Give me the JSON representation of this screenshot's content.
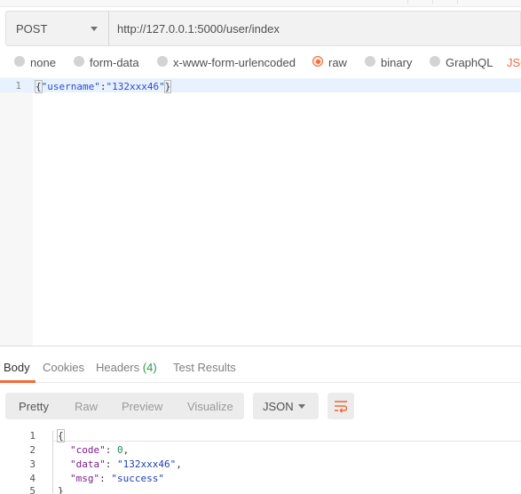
{
  "request": {
    "method": "POST",
    "url": "http://127.0.0.1:5000/user/index"
  },
  "body_types": {
    "options": [
      "none",
      "form-data",
      "x-www-form-urlencoded",
      "raw",
      "binary",
      "GraphQL"
    ],
    "selected": "raw",
    "format_label_partial": "JSO"
  },
  "editor": {
    "line_number": "1",
    "brace_open": "{",
    "key": "\"username\"",
    "colon": ":",
    "value": "\"132xxx46\"",
    "brace_close": "}"
  },
  "response": {
    "tabs": {
      "body": "Body",
      "cookies": "Cookies",
      "headers": "Headers",
      "headers_count": "(4)",
      "test_results": "Test Results"
    },
    "views": [
      "Pretty",
      "Raw",
      "Preview",
      "Visualize"
    ],
    "active_view": "Pretty",
    "format": "JSON",
    "lines": [
      {
        "n": "1",
        "text": "{"
      },
      {
        "n": "2",
        "key": "\"code\"",
        "sep": ": ",
        "val": "0",
        "tail": ","
      },
      {
        "n": "3",
        "key": "\"data\"",
        "sep": ": ",
        "val": "\"132xxx46\"",
        "tail": ","
      },
      {
        "n": "4",
        "key": "\"msg\"",
        "sep": ": ",
        "val": "\"success\"",
        "tail": ""
      },
      {
        "n": "5",
        "text": "}"
      }
    ]
  },
  "colors": {
    "accent": "#f26b3a",
    "count_green": "#2a9d4a",
    "string_blue": "#1d3fb8"
  }
}
